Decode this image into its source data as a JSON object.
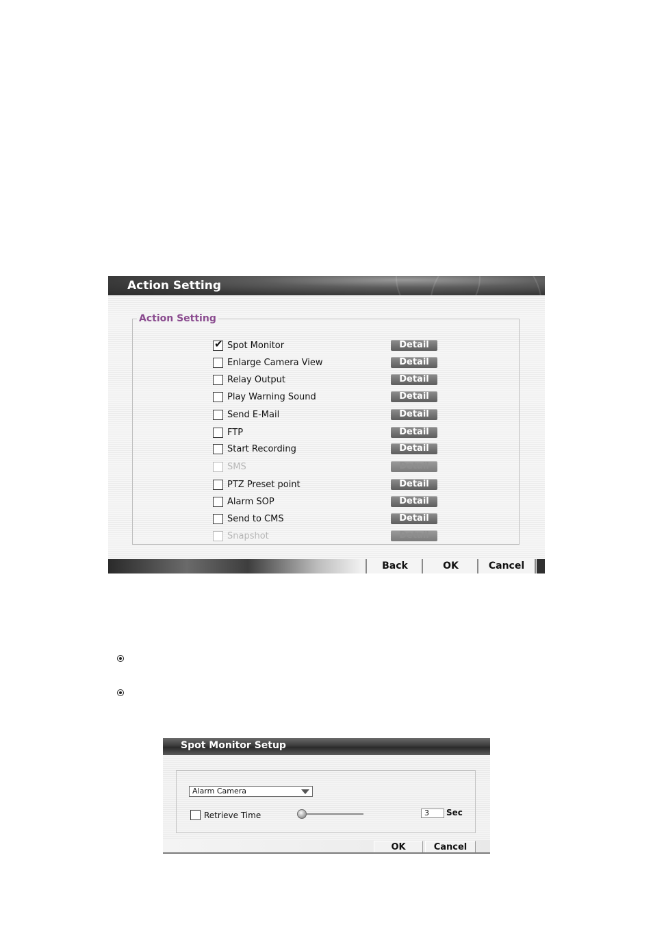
{
  "action_window": {
    "title": "Action Setting",
    "group_title": "Action Setting",
    "detail_label": "Detail",
    "actions": [
      {
        "label": "Spot Monitor",
        "checked": true,
        "enabled": true
      },
      {
        "label": "Enlarge Camera View",
        "checked": false,
        "enabled": true
      },
      {
        "label": "Relay Output",
        "checked": false,
        "enabled": true
      },
      {
        "label": "Play Warning Sound",
        "checked": false,
        "enabled": true
      },
      {
        "label": "Send E-Mail",
        "checked": false,
        "enabled": true
      },
      {
        "label": "FTP",
        "checked": false,
        "enabled": true
      },
      {
        "label": "Start Recording",
        "checked": false,
        "enabled": true
      },
      {
        "label": "SMS",
        "checked": false,
        "enabled": false
      },
      {
        "label": "PTZ Preset point",
        "checked": false,
        "enabled": true
      },
      {
        "label": "Alarm SOP",
        "checked": false,
        "enabled": true
      },
      {
        "label": "Send to CMS",
        "checked": false,
        "enabled": true
      },
      {
        "label": "Snapshot",
        "checked": false,
        "enabled": false
      }
    ],
    "buttons": {
      "back": "Back",
      "ok": "OK",
      "cancel": "Cancel"
    }
  },
  "spot_window": {
    "title": "Spot Monitor Setup",
    "camera_select": "Alarm Camera",
    "retrieve_label": "Retrieve Time",
    "retrieve_checked": false,
    "time_value": "3",
    "time_unit": "Sec",
    "buttons": {
      "ok": "OK",
      "cancel": "Cancel"
    }
  }
}
